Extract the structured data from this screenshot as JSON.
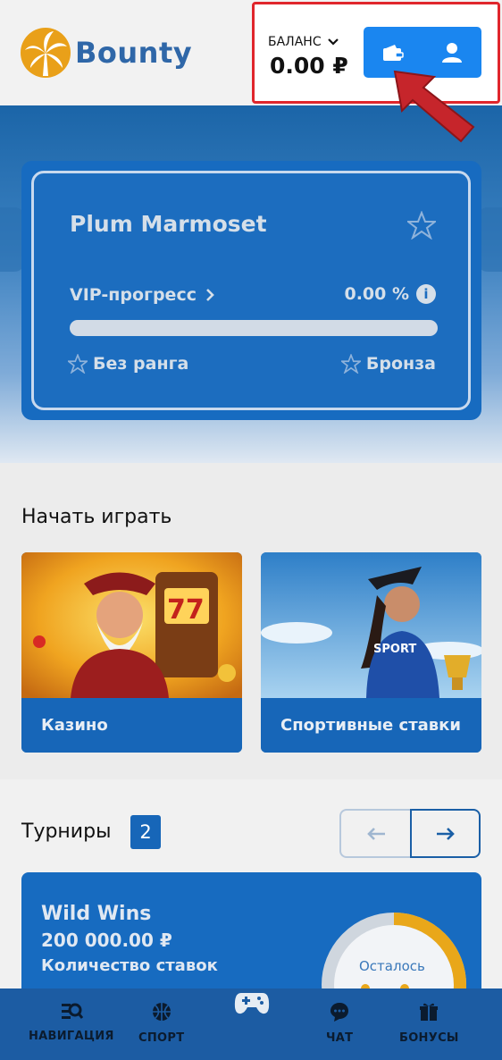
{
  "header": {
    "logo_text": "Bounty",
    "balance_label": "БАЛАНС",
    "balance_amount": "0.00 ₽",
    "wallet_icon": "wallet-icon",
    "user_icon": "user-icon",
    "highlight_color": "#e0262c",
    "accent": "#1a86f0"
  },
  "vip": {
    "name": "Plum Marmoset",
    "progress_label": "VIP-прогресс",
    "progress_percent_text": "0.00 %",
    "progress_value": 0,
    "current_rank": "Без ранга",
    "next_rank": "Бронза"
  },
  "start_playing": {
    "title": "Начать играть",
    "cards": [
      {
        "label": "Казино"
      },
      {
        "label": "Спортивные ставки"
      }
    ],
    "sport_jersey_text": "SPORT"
  },
  "tournaments": {
    "title": "Турниры",
    "count": "2",
    "prev_icon": "arrow-left-icon",
    "next_icon": "arrow-right-icon",
    "card": {
      "name": "Wild Wins",
      "prize": "200 000.00 ₽",
      "bets_label": "Количество ставок",
      "remaining_label": "Осталось"
    }
  },
  "bottom_nav": {
    "items": [
      {
        "label": "НАВИГАЦИЯ",
        "icon": "navigation-search-icon"
      },
      {
        "label": "СПОРТ",
        "icon": "basketball-icon"
      },
      {
        "label": "",
        "icon": "gamepad-icon"
      },
      {
        "label": "ЧАТ",
        "icon": "chat-icon"
      },
      {
        "label": "БОНУСЫ",
        "icon": "gift-icon"
      }
    ]
  }
}
